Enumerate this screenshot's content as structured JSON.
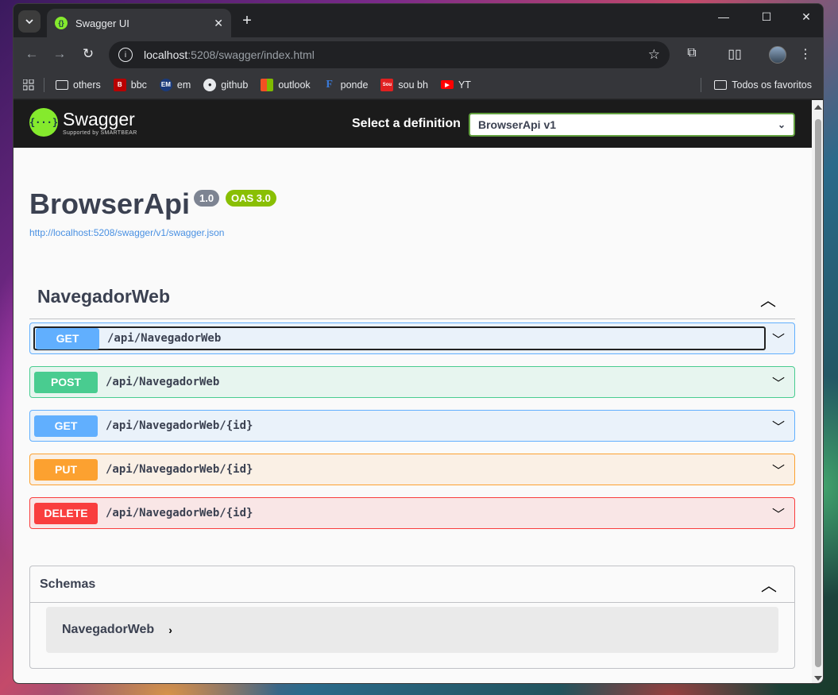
{
  "browser": {
    "tab_title": "Swagger UI",
    "url_host": "localhost",
    "url_path": ":5208/swagger/index.html",
    "bookmarks": [
      {
        "label": "others",
        "icon": "folder-icon"
      },
      {
        "label": "bbc",
        "icon": "bbc-icon",
        "color": "#b80000"
      },
      {
        "label": "em",
        "icon": "em-icon",
        "color": "#1a3a7a"
      },
      {
        "label": "github",
        "icon": "github-icon"
      },
      {
        "label": "outlook",
        "icon": "outlook-icon"
      },
      {
        "label": "ponde",
        "icon": "ponde-icon"
      },
      {
        "label": "sou bh",
        "icon": "sou-bh-icon",
        "color": "#e02020"
      },
      {
        "label": "YT",
        "icon": "youtube-icon",
        "color": "#ff0000"
      }
    ],
    "all_bookmarks": "Todos os favoritos"
  },
  "swagger": {
    "logo_name": "Swagger",
    "logo_sub": "Supported by SMARTBEAR",
    "select_label": "Select a definition",
    "selected_definition": "BrowserApi v1",
    "api_title": "BrowserApi",
    "version_badge": "1.0",
    "oas_badge": "OAS 3.0",
    "spec_url": "http://localhost:5208/swagger/v1/swagger.json",
    "tag": "NavegadorWeb",
    "operations": [
      {
        "method": "GET",
        "path": "/api/NavegadorWeb"
      },
      {
        "method": "POST",
        "path": "/api/NavegadorWeb"
      },
      {
        "method": "GET",
        "path": "/api/NavegadorWeb/{id}"
      },
      {
        "method": "PUT",
        "path": "/api/NavegadorWeb/{id}"
      },
      {
        "method": "DELETE",
        "path": "/api/NavegadorWeb/{id}"
      }
    ],
    "schemas_title": "Schemas",
    "schemas": [
      "NavegadorWeb"
    ]
  },
  "colors": {
    "get": "#61affe",
    "post": "#49cc90",
    "put": "#fca130",
    "delete": "#f93e3e",
    "swagger_green": "#85ea2d",
    "version_badge": "#7d8492",
    "oas_badge": "#89bf04"
  }
}
